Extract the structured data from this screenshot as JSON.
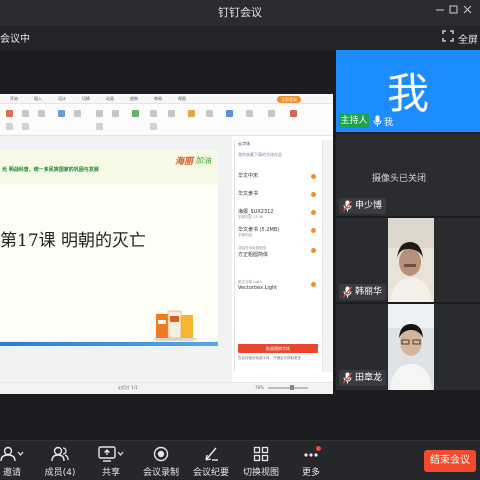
{
  "window": {
    "title": "钉钉会议",
    "status": "会议中",
    "fullscreen_label": "全屏"
  },
  "share": {
    "slide_title": "第17课  明朝的灭亡",
    "banner": "光 明战科普，统一多民族国家的巩固与发展",
    "logo": "海丽",
    "logo2": "加油",
    "login_label": "立即登录",
    "panel_title": "云字体",
    "panel_sub": "我的收藏下载的字体在此",
    "fonts": [
      {
        "name": "华文中宋",
        "sub": ""
      },
      {
        "name": "华文隶书",
        "sub": ""
      },
      {
        "name": "海报_SUX2312",
        "sub": "字体内容 12.5K"
      },
      {
        "name": "华文隶书 (5.2MB)",
        "sub": "字体内容"
      },
      {
        "name": "方正粗圆简体",
        "sub": "非会员可免费使用"
      },
      {
        "name": "Vectorbex Light",
        "sub": "英文字体 Light"
      }
    ],
    "panel_button": "批量替换字体",
    "panel_foot": "仅支持使用免费字体，开通会员获取更多",
    "status_left": "幻灯片 1/1",
    "zoom": "78%"
  },
  "participants": {
    "me": {
      "char": "我",
      "role": "主持人",
      "name": "我"
    },
    "tile2": {
      "camera_off": "摄像头已关闭",
      "name": "申少博"
    },
    "tile3": {
      "name": "韩丽华"
    },
    "tile4": {
      "name": "田章龙"
    }
  },
  "toolbar": {
    "items": [
      {
        "label": "邀请",
        "icon": "invite-icon"
      },
      {
        "label": "成员(4)",
        "icon": "members-icon"
      },
      {
        "label": "共享",
        "icon": "share-icon"
      },
      {
        "label": "会议录制",
        "icon": "record-icon"
      },
      {
        "label": "会议纪要",
        "icon": "minutes-icon"
      },
      {
        "label": "切换视图",
        "icon": "layout-icon"
      },
      {
        "label": "更多",
        "icon": "more-icon"
      }
    ],
    "end_label": "结束会议"
  },
  "colors": {
    "accent": "#1d8cff",
    "host": "#1ca34f",
    "end": "#f34a2e"
  }
}
